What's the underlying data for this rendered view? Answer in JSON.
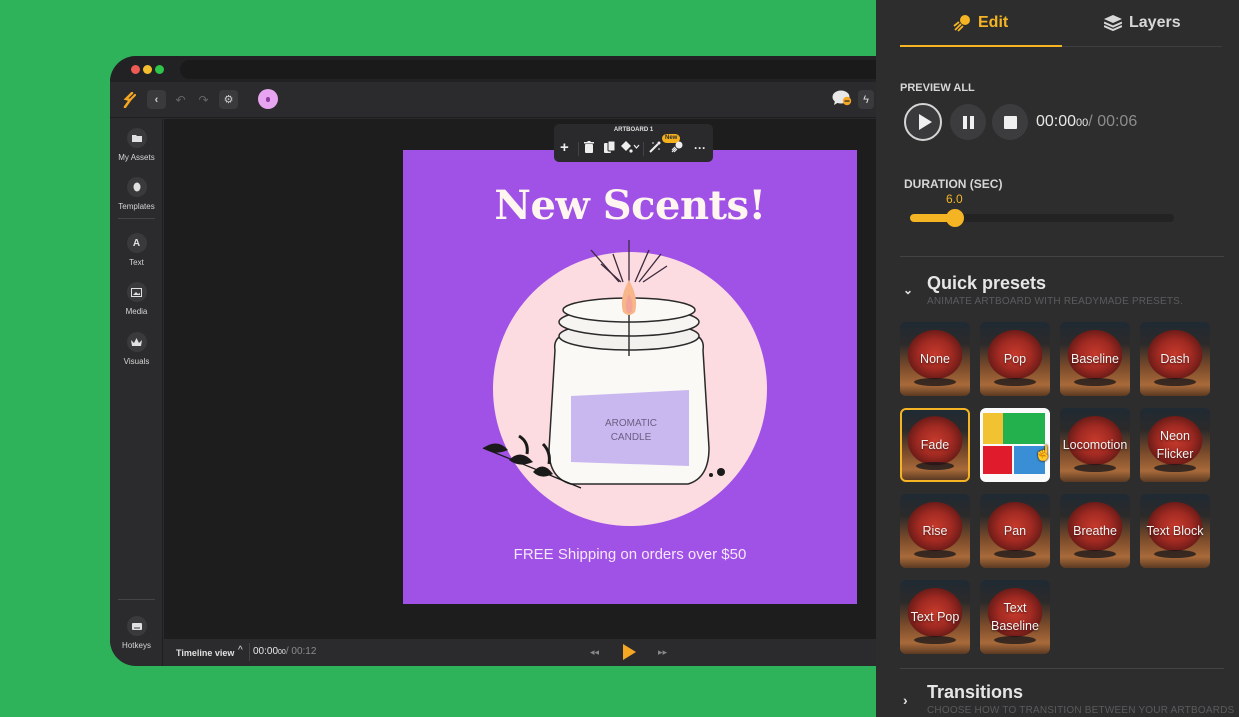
{
  "app": {
    "toolbar": {
      "logo_icon": "brand-bolt-icon",
      "back_icon": "chevron-left-icon",
      "undo_icon": "undo-icon",
      "redo_icon": "redo-icon",
      "settings_icon": "gear-icon"
    },
    "sidebar": {
      "items": [
        {
          "label": "My Assets",
          "icon": "folder-icon"
        },
        {
          "label": "Templates",
          "icon": "templates-icon"
        },
        {
          "label": "Text",
          "icon": "text-icon",
          "glyph": "A"
        },
        {
          "label": "Media",
          "icon": "image-icon"
        },
        {
          "label": "Visuals",
          "icon": "crown-icon"
        }
      ],
      "bottom": {
        "label": "Hotkeys",
        "icon": "keyboard-icon"
      }
    },
    "artboard_toolbar": {
      "title": "ARTBOARD 1",
      "new_badge": "New"
    },
    "artboard": {
      "title": "New Scents!",
      "label_line1": "AROMATIC",
      "label_line2": "CANDLE",
      "subtitle": "FREE Shipping on orders over $50"
    },
    "timeline": {
      "label": "Timeline view",
      "current": "00:00",
      "current_frames": "00",
      "total": "/ 00:12"
    }
  },
  "panel": {
    "tabs": [
      {
        "label": "Edit",
        "active": true,
        "icon": "animation-icon"
      },
      {
        "label": "Layers",
        "active": false,
        "icon": "layers-icon"
      }
    ],
    "preview": {
      "label": "PREVIEW ALL",
      "current": "00:00",
      "current_frames": "00",
      "total": "/ 00:06"
    },
    "duration": {
      "label": "DURATION (SEC)",
      "value": "6.0",
      "fraction": 0.17
    },
    "quick_presets": {
      "title": "Quick presets",
      "description": "ANIMATE ARTBOARD WITH READYMADE PRESETS.",
      "items": [
        {
          "label": "None"
        },
        {
          "label": "Pop"
        },
        {
          "label": "Baseline"
        },
        {
          "label": "Dash"
        },
        {
          "label": "Fade",
          "selected": true
        },
        {
          "label": "",
          "special": true
        },
        {
          "label": "Locomotion"
        },
        {
          "label": "Neon Flicker"
        },
        {
          "label": "Rise"
        },
        {
          "label": "Pan"
        },
        {
          "label": "Breathe"
        },
        {
          "label": "Text Block"
        },
        {
          "label": "Text Pop"
        },
        {
          "label": "Text Baseline"
        }
      ]
    },
    "transitions": {
      "title": "Transitions",
      "description": "CHOOSE HOW TO TRANSITION BETWEEN YOUR ARTBOARDS"
    }
  },
  "colors": {
    "accent": "#f5b423",
    "background": "#2eb35a",
    "artboard": "#a052e6",
    "panel": "#2d2d2e"
  }
}
